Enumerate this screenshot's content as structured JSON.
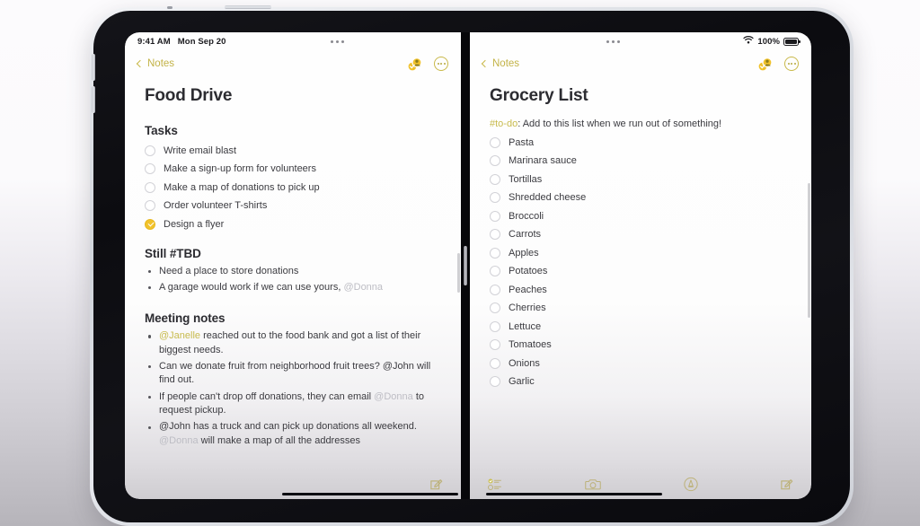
{
  "status_bar": {
    "time": "9:41 AM",
    "date": "Mon Sep 20",
    "battery_percent": "100%",
    "wifi_icon": "wifi-icon",
    "battery_icon": "battery-icon",
    "multitask_icon": "multitask-dots-icon"
  },
  "accent": {
    "yellow": "#c8bb4e",
    "check_fill": "#f1c22b",
    "text": "#2c2c31",
    "mention_grey": "#bdbdc4"
  },
  "left_pane": {
    "back_label": "Notes",
    "back_icon": "chevron-left-icon",
    "share_icon": "share-person-icon",
    "more_icon": "more-circle-icon",
    "note_title": "Food Drive",
    "sections": [
      {
        "heading": "Tasks",
        "type": "checklist",
        "items": [
          {
            "label": "Write email blast",
            "checked": false
          },
          {
            "label": "Make a sign-up form for volunteers",
            "checked": false
          },
          {
            "label": "Make a map of donations to pick up",
            "checked": false
          },
          {
            "label": "Order volunteer T-shirts",
            "checked": false
          },
          {
            "label": "Design a flyer",
            "checked": true
          }
        ]
      },
      {
        "heading": "Still #TBD",
        "type": "bullets",
        "items": [
          {
            "parts": [
              {
                "t": "Need a place to store donations",
                "s": "plain"
              }
            ]
          },
          {
            "parts": [
              {
                "t": "A garage would work if we can use yours, ",
                "s": "plain"
              },
              {
                "t": "@Donna",
                "s": "mention"
              }
            ]
          }
        ]
      },
      {
        "heading": "Meeting notes",
        "type": "bullets",
        "items": [
          {
            "parts": [
              {
                "t": "@Janelle",
                "s": "mention-hl"
              },
              {
                "t": " reached out to the food bank and got a list of their biggest needs.",
                "s": "plain"
              }
            ]
          },
          {
            "parts": [
              {
                "t": "Can we donate fruit from neighborhood fruit trees? @John will find out.",
                "s": "plain"
              }
            ]
          },
          {
            "parts": [
              {
                "t": "If people can't drop off donations, they can email ",
                "s": "plain"
              },
              {
                "t": "@Donna",
                "s": "mention"
              },
              {
                "t": " to request pickup.",
                "s": "plain"
              }
            ]
          },
          {
            "parts": [
              {
                "t": "@John has a truck and can pick up donations all weekend. ",
                "s": "plain"
              },
              {
                "t": "@Donna",
                "s": "mention"
              },
              {
                "t": " will make a map of all the addresses",
                "s": "plain"
              }
            ]
          }
        ]
      }
    ],
    "toolbar": [
      {
        "name": "compose-icon",
        "label": "Compose"
      }
    ]
  },
  "right_pane": {
    "back_label": "Notes",
    "back_icon": "chevron-left-icon",
    "share_icon": "share-person-icon",
    "more_icon": "more-circle-icon",
    "note_title": "Grocery List",
    "intro": {
      "tag": "#to-do",
      "text": ": Add to this list when we run out of something!"
    },
    "items": [
      {
        "label": "Pasta",
        "checked": false
      },
      {
        "label": "Marinara sauce",
        "checked": false
      },
      {
        "label": "Tortillas",
        "checked": false
      },
      {
        "label": "Shredded cheese",
        "checked": false
      },
      {
        "label": "Broccoli",
        "checked": false
      },
      {
        "label": "Carrots",
        "checked": false
      },
      {
        "label": "Apples",
        "checked": false
      },
      {
        "label": "Potatoes",
        "checked": false
      },
      {
        "label": "Peaches",
        "checked": false
      },
      {
        "label": "Cherries",
        "checked": false
      },
      {
        "label": "Lettuce",
        "checked": false
      },
      {
        "label": "Tomatoes",
        "checked": false
      },
      {
        "label": "Onions",
        "checked": false
      },
      {
        "label": "Garlic",
        "checked": false
      }
    ],
    "toolbar": [
      {
        "name": "checklist-icon",
        "label": "Checklist"
      },
      {
        "name": "camera-icon",
        "label": "Camera"
      },
      {
        "name": "markup-icon",
        "label": "Markup"
      },
      {
        "name": "compose-icon",
        "label": "Compose"
      }
    ]
  }
}
